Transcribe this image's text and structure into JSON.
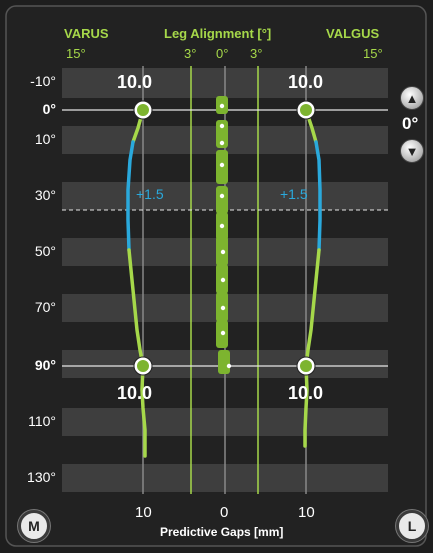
{
  "header": {
    "varus": "VARUS",
    "title": "Leg Alignment [°]",
    "valgus": "VALGUS",
    "left_deg": "15°",
    "tick_3_left": "3°",
    "tick_0": "0°",
    "tick_3_right": "3°",
    "right_deg": "15°"
  },
  "rows": [
    "-10°",
    "0°",
    "10°",
    "30°",
    "50°",
    "70°",
    "90°",
    "110°",
    "130°"
  ],
  "gaps": {
    "top_left": "10.0",
    "top_right": "10.0",
    "bottom_left": "10.0",
    "bottom_right": "10.0",
    "offset_left": "+1.5",
    "offset_right": "+1.5"
  },
  "angle_control": {
    "up_icon": "▲",
    "value": "0°",
    "down_icon": "▼"
  },
  "footer": {
    "left_num": "10",
    "center_num": "0",
    "right_num": "10",
    "label": "Predictive Gaps [mm]",
    "left_button": "M",
    "right_button": "L"
  },
  "colors": {
    "accent_green": "#a6d84a",
    "curve_blue": "#2aa9dc",
    "background": "#1e1e1e"
  },
  "icons": [
    "chevron-up-icon",
    "chevron-down-icon"
  ]
}
